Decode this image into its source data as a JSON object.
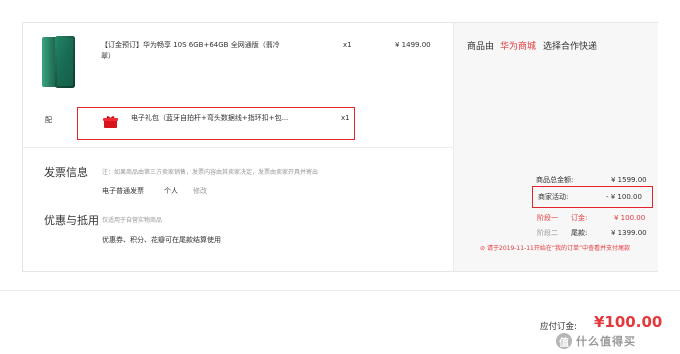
{
  "product": {
    "title": "【订金预订】华为畅享 10S 6GB+64GB 全网通版（翡冷翠）",
    "title_line1": "【订金预订】华为畅享 10S 6GB+64GB 全网通版（翡冷",
    "title_line2": "翠）",
    "qty": "x1",
    "price": "¥ 1499.00"
  },
  "gift": {
    "section_label": "配",
    "name": "电子礼包（蓝牙自拍杆+弯头数据线+指环扣+包...",
    "qty": "x1"
  },
  "seller": {
    "prefix": "商品由",
    "name": "华为商城",
    "suffix": "选择合作快递"
  },
  "invoice": {
    "heading": "发票信息",
    "note": "注：如果商品由第三方卖家销售，发票内容由其卖家决定，发票由卖家开具并寄出",
    "type": "电子普通发票",
    "holder": "个人",
    "edit_link": "修改"
  },
  "discount": {
    "heading": "优惠与抵用",
    "note": "仅适用于自营实物商品",
    "text": "优惠券、积分、花瓣可在尾款结算使用"
  },
  "summary": {
    "goods_total_label": "商品总金额:",
    "goods_total_value": "¥ 1599.00",
    "merchant_activity_label": "商家活动:",
    "merchant_activity_value": "- ¥ 100.00",
    "stage1_label": "阶段一",
    "deposit_label": "订金:",
    "deposit_value": "¥ 100.00",
    "stage2_label": "阶段二",
    "balance_label": "尾款:",
    "balance_value": "¥ 1399.00",
    "notice": "请于2019-11-11开始在“我的订单”中查看并支付尾款"
  },
  "footer": {
    "payable_label": "应付订金:",
    "payable_value": "¥100.00"
  },
  "watermark": {
    "icon_char": "值",
    "text": "什么值得买"
  },
  "colors": {
    "accent_red": "#e4393c",
    "highlight_box": "#e4242b",
    "phone_green": "#1f6b54"
  }
}
